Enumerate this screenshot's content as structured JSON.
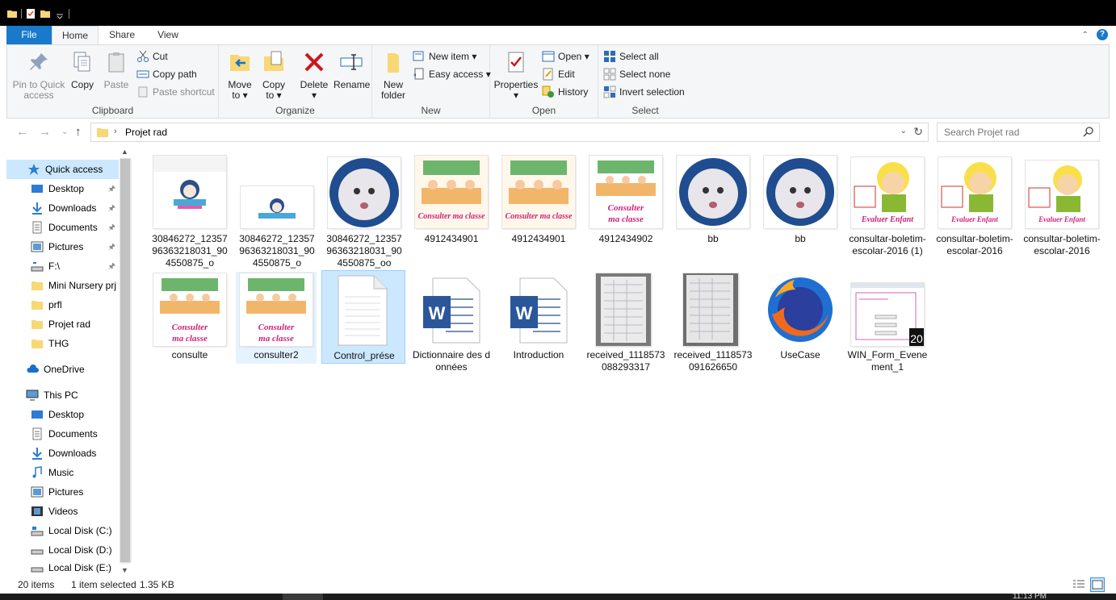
{
  "tabs": {
    "file": "File",
    "home": "Home",
    "share": "Share",
    "view": "View"
  },
  "ribbon": {
    "clipboard": {
      "label": "Clipboard",
      "pin": [
        "Pin to Quick",
        "access"
      ],
      "copy": "Copy",
      "paste": "Paste",
      "cut": "Cut",
      "copy_path": "Copy path",
      "paste_shortcut": "Paste shortcut"
    },
    "organize": {
      "label": "Organize",
      "move_to": [
        "Move",
        "to ▾"
      ],
      "copy_to": [
        "Copy",
        "to ▾"
      ],
      "delete": [
        "Delete",
        "▾"
      ],
      "rename": "Rename"
    },
    "new": {
      "label": "New",
      "new_folder": [
        "New",
        "folder"
      ],
      "new_item": "New item ▾",
      "easy_access": "Easy access ▾"
    },
    "open": {
      "label": "Open",
      "properties": [
        "Properties",
        "▾"
      ],
      "open": "Open ▾",
      "edit": "Edit",
      "history": "History"
    },
    "select": {
      "label": "Select",
      "select_all": "Select all",
      "select_none": "Select none",
      "invert": "Invert selection"
    }
  },
  "address": {
    "crumb": "Projet rad",
    "search_placeholder": "Search Projet rad"
  },
  "nav": {
    "quick_access": "Quick access",
    "quick_items": [
      "Desktop",
      "Downloads",
      "Documents",
      "Pictures",
      "F:\\",
      "Mini Nursery prj",
      "prfl",
      "Projet rad",
      "THG"
    ],
    "onedrive": "OneDrive",
    "this_pc": "This PC",
    "pc_items": [
      "Desktop",
      "Documents",
      "Downloads",
      "Music",
      "Pictures",
      "Videos",
      "Local Disk (C:)",
      "Local Disk (D:)",
      "Local Disk (E:)"
    ]
  },
  "files": [
    "30846272_1235796363218031_904550875_o",
    "30846272_1235796363218031_904550875_o",
    "30846272_1235796363218031_904550875_oo",
    "4912434901",
    "4912434901",
    "4912434902",
    "bb",
    "bb",
    "consultar-boletim-escolar-2016 (1)",
    "consultar-boletim-escolar-2016",
    "consultar-boletim-escolar-2016",
    "consulte",
    "consulter2",
    "Control_prése",
    "Dictionnaire des données",
    "Introduction",
    "received_1118573088293317",
    "received_1118573091626650",
    "UseCase",
    "WIN_Form_Evenement_1"
  ],
  "thumb_text": {
    "consulter": "Consulter ma classe",
    "consulter2a": "Consulter",
    "consulter2b": "ma classe",
    "evaluer": "Evaluer Enfant",
    "word": "W",
    "win_badge": "20"
  },
  "status": {
    "count": "20 items",
    "selected": "1 item selected",
    "size": "1.35 KB"
  },
  "taskbar": {
    "clock": "11:13 PM"
  },
  "colors": {
    "accent": "#1979ca",
    "selection": "#cce8ff",
    "folder": "#f8d775"
  }
}
